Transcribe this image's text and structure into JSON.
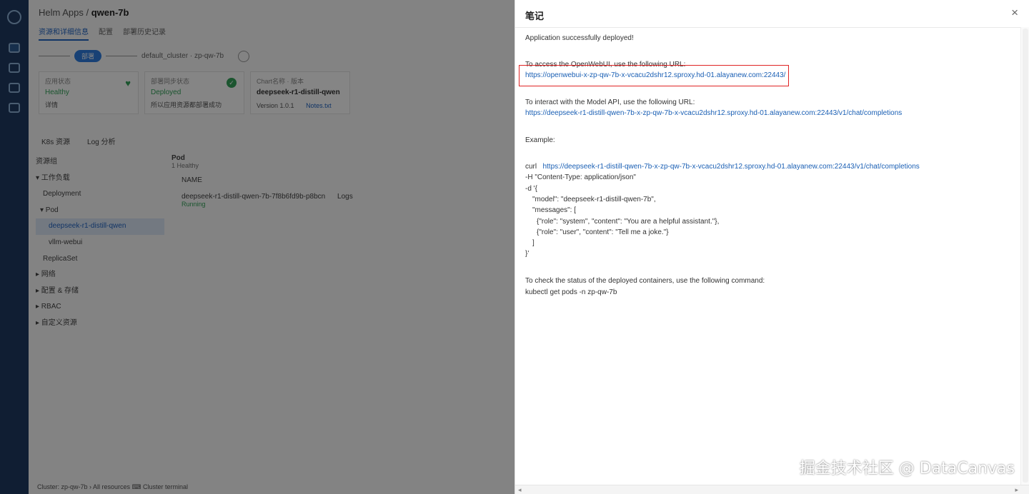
{
  "background_app": {
    "breadcrumb_parent": "Helm Apps",
    "breadcrumb_current": "qwen-7b",
    "tabs": [
      "资源和详细信息",
      "配置",
      "部署历史记录"
    ],
    "pill_label": "部署",
    "cluster_label": "default_cluster · zp-qw-7b",
    "cards": [
      {
        "title": "应用状态",
        "value": "Healthy",
        "foot": "详情"
      },
      {
        "title": "部署同步状态",
        "value": "Deployed",
        "foot": "所以应用资源都部署成功"
      },
      {
        "title": "Chart名称 · 版本",
        "value": "deepseek-r1-distill-qwen",
        "foot": "Version 1.0.1",
        "foot_link": "Notes.txt"
      }
    ],
    "sub_tabs": [
      "K8s 资源",
      "Log 分析"
    ],
    "tree": [
      "资源组",
      "▾ 工作负载",
      "Deployment",
      "▾ Pod",
      "deepseek-r1-distill-qwen",
      "vllm-webui",
      "ReplicaSet",
      "▸ 网络",
      "▸ 配置 & 存储",
      "▸ RBAC",
      "▸ 自定义资源"
    ],
    "pod_header": "Pod",
    "pod_sub": "1 Healthy",
    "pod_name_col": "NAME",
    "pod_row": "deepseek-r1-distill-qwen-7b-7f8b6fd9b-p8bcn",
    "pod_logs": "Logs",
    "pod_status": "Running",
    "statusbar": "Cluster: zp-qw-7b  ›  All resources   ⌨ Cluster terminal"
  },
  "panel": {
    "title": "笔记",
    "close_label": "×",
    "lines": {
      "deployed": "Application successfully deployed!",
      "access": "To access the OpenWebUI, use the following URL:",
      "access_url": "https://openwebui-x-zp-qw-7b-x-vcacu2dshr12.sproxy.hd-01.alayanew.com:22443/",
      "interact": "To interact with the Model API, use the following URL:",
      "api_url": "https://deepseek-r1-distill-qwen-7b-x-zp-qw-7b-x-vcacu2dshr12.sproxy.hd-01.alayanew.com:22443/v1/chat/completions",
      "example": "Example:",
      "curl_prefix": "curl",
      "curl_url": "https://deepseek-r1-distill-qwen-7b-x-zp-qw-7b-x-vcacu2dshr12.sproxy.hd-01.alayanew.com:22443/v1/chat/completions",
      "header": "-H \"Content-Type: application/json\"",
      "d": "-d '{",
      "model": "\"model\": \"deepseek-r1-distill-qwen-7b\",",
      "messages": "\"messages\": [",
      "sys_msg": "{\"role\": \"system\", \"content\": \"You are a helpful assistant.\"},",
      "user_msg": "{\"role\": \"user\", \"content\": \"Tell me a joke.\"}",
      "close_bracket": "]",
      "close_brace": "}'",
      "check": "To check the status of the deployed containers, use the following command:",
      "kubectl": "kubectl get pods -n zp-qw-7b"
    }
  },
  "watermark": "掘金技术社区 @ DataCanvas",
  "colors": {
    "link": "#1a5fb4",
    "highlight_box": "#e02424",
    "sidebar": "#1f3a63"
  }
}
